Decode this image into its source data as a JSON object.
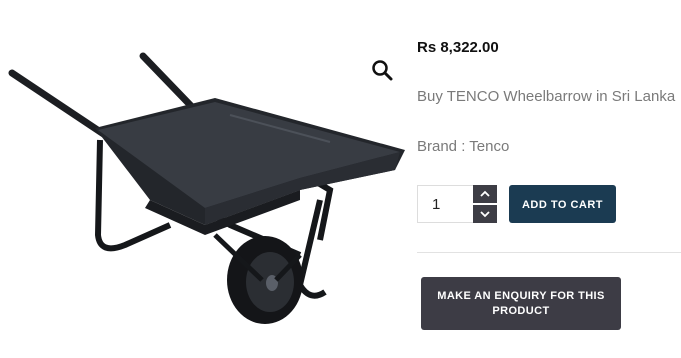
{
  "product": {
    "price": "Rs 8,322.00",
    "title": "Buy TENCO Wheelbarrow in Sri Lanka",
    "brand": "Brand : Tenco",
    "image_icon": "wheelbarrow-product-image"
  },
  "zoom": {
    "icon": "magnifier-icon"
  },
  "cart": {
    "quantity": "1",
    "add_to_cart_label": "ADD TO CART",
    "increment_icon": "chevron-up-icon",
    "decrement_icon": "chevron-down-icon"
  },
  "enquiry": {
    "label": "MAKE AN ENQUIRY FOR THIS PRODUCT"
  },
  "colors": {
    "add_to_cart_bg": "#1b3b52",
    "enquiry_bg": "#3d3c45",
    "muted_text": "#7a7a7a"
  }
}
